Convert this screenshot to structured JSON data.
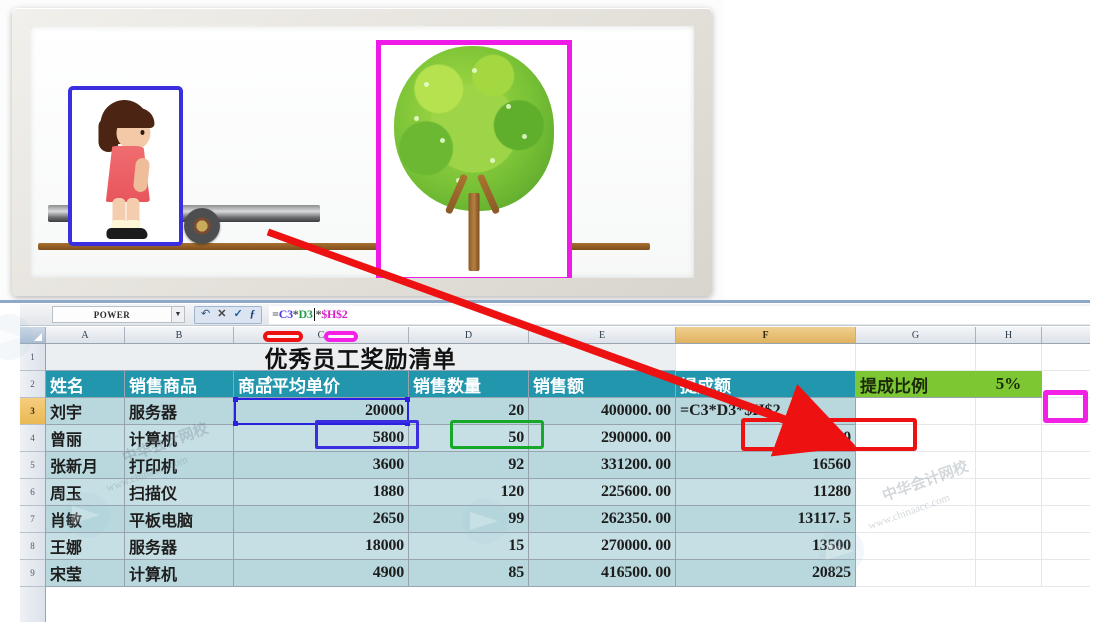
{
  "illustration": {
    "girl_box_label": "relative-reference-girl-on-cart",
    "tree_box_label": "absolute-reference-fixed-tree",
    "colors": {
      "girl_border": "#3b2ee0",
      "tree_border": "#ef19e8",
      "arrow": "#ee1111"
    }
  },
  "excel": {
    "name_box": {
      "value": "POWER"
    },
    "formula_bar": {
      "equals": "=",
      "ref1": "C3",
      "op1": "*",
      "ref2": "D3",
      "op2": "*",
      "ref3": "$H$2",
      "full": "=C3*D3*$H$2"
    },
    "formula_buttons": {
      "undo": "↶",
      "cancel": "✕",
      "enter": "✓",
      "fx": "ƒ"
    },
    "column_headers": [
      "A",
      "B",
      "C",
      "D",
      "E",
      "F",
      "G",
      "H"
    ],
    "selected_column": "F",
    "row_headers": [
      "1",
      "2",
      "3",
      "4",
      "5",
      "6",
      "7",
      "8",
      "9"
    ],
    "selected_row": "3",
    "title": "优秀员工奖励清单",
    "table_headers": [
      "姓名",
      "销售商品",
      "商品平均单价",
      "销售数量",
      "销售额",
      "提成额"
    ],
    "commission_label": "提成比例",
    "commission_value": "5%",
    "rows": [
      {
        "row": "3",
        "name": "刘宇",
        "product": "服务器",
        "price": "20000",
        "qty": "20",
        "amount": "400000. 00",
        "commission": "=C3*D3*$H$2"
      },
      {
        "row": "4",
        "name": "曾丽",
        "product": "计算机",
        "price": "5800",
        "qty": "50",
        "amount": "290000. 00",
        "commission": "14500"
      },
      {
        "row": "5",
        "name": "张新月",
        "product": "打印机",
        "price": "3600",
        "qty": "92",
        "amount": "331200. 00",
        "commission": "16560"
      },
      {
        "row": "6",
        "name": "周玉",
        "product": "扫描仪",
        "price": "1880",
        "qty": "120",
        "amount": "225600. 00",
        "commission": "11280"
      },
      {
        "row": "7",
        "name": "肖敏",
        "product": "平板电脑",
        "price": "2650",
        "qty": "99",
        "amount": "262350. 00",
        "commission": "13117. 5"
      },
      {
        "row": "8",
        "name": "王娜",
        "product": "服务器",
        "price": "18000",
        "qty": "15",
        "amount": "270000. 00",
        "commission": "13500"
      },
      {
        "row": "9",
        "name": "宋莹",
        "product": "计算机",
        "price": "4900",
        "qty": "85",
        "amount": "416500. 00",
        "commission": "20825"
      }
    ],
    "annotations": {
      "c3_box_color": "#3b2ee0",
      "d3_box_color": "#17a829",
      "f3_box_color": "#ee1111",
      "h2_box_color": "#f321e6"
    }
  },
  "watermarks": {
    "w1": "中华会计网校",
    "w2": "www.chinaacc.com",
    "w3": "中华会计网校",
    "w4": "www.chinaacc.com"
  }
}
